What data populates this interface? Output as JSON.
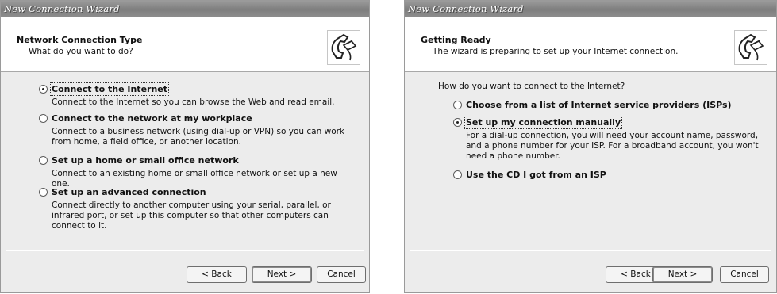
{
  "left_window": {
    "title": "New Connection Wizard",
    "header": {
      "title": "Network Connection Type",
      "subtitle": "What do you want to do?",
      "icon": "phone-network-icon"
    },
    "options": [
      {
        "label": "Connect to the Internet",
        "description": "Connect to the Internet so you can browse the Web and read email.",
        "selected": true
      },
      {
        "label": "Connect to the network at my workplace",
        "description": "Connect to a business network (using dial-up or VPN) so you can work from home, a field office, or another location.",
        "selected": false
      },
      {
        "label": "Set up a home or small office network",
        "description": "Connect to an existing home or small office network or set up a new one.",
        "selected": false
      },
      {
        "label": "Set up an advanced connection",
        "description": "Connect directly to another computer using your serial, parallel, or infrared port, or set up this computer so that other computers can connect to it.",
        "selected": false
      }
    ],
    "buttons": {
      "back": "< Back",
      "next": "Next >",
      "cancel": "Cancel"
    }
  },
  "right_window": {
    "title": "New Connection Wizard",
    "header": {
      "title": "Getting Ready",
      "subtitle": "The wizard is preparing to set up your Internet connection.",
      "icon": "phone-network-icon"
    },
    "prompt": "How do you want to connect to the Internet?",
    "options": [
      {
        "label": "Choose from a list of Internet service providers (ISPs)",
        "selected": false
      },
      {
        "label": "Set up my connection manually",
        "description": "For a dial-up connection, you will need your account name, password, and a phone number for your ISP. For a broadband account, you won't need a phone number.",
        "selected": true
      },
      {
        "label": "Use the CD I got from an ISP",
        "selected": false
      }
    ],
    "buttons": {
      "back": "< Back",
      "next": "Next >",
      "cancel": "Cancel"
    }
  }
}
